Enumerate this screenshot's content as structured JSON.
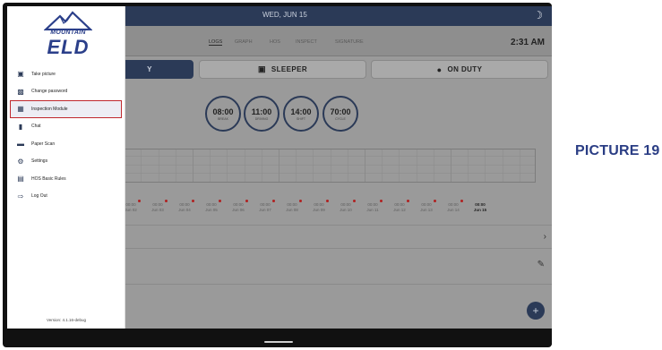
{
  "topbar": {
    "date": "WED, JUN 15",
    "clock": "2:31 AM"
  },
  "tabs": [
    "LOGS",
    "GRAPH",
    "HOS",
    "INSPECT",
    "SIGNATURE"
  ],
  "status_buttons": {
    "first": "Y",
    "sleeper": "SLEEPER",
    "on_duty": "ON DUTY"
  },
  "timers": [
    {
      "value": "08:00",
      "label": "BREAK"
    },
    {
      "value": "11:00",
      "label": "DRIVING"
    },
    {
      "value": "14:00",
      "label": "SHIFT"
    },
    {
      "value": "70:00",
      "label": "CYCLE"
    }
  ],
  "dates": [
    {
      "l1": "00:00",
      "l2": "Jun 02"
    },
    {
      "l1": "00:00",
      "l2": "Jun 03"
    },
    {
      "l1": "00:00",
      "l2": "Jun 04"
    },
    {
      "l1": "00:00",
      "l2": "Jun 05"
    },
    {
      "l1": "00:00",
      "l2": "Jun 06"
    },
    {
      "l1": "00:00",
      "l2": "Jun 07"
    },
    {
      "l1": "00:00",
      "l2": "Jun 08"
    },
    {
      "l1": "00:00",
      "l2": "Jun 09"
    },
    {
      "l1": "00:00",
      "l2": "Jun 10"
    },
    {
      "l1": "00:00",
      "l2": "Jun 11"
    },
    {
      "l1": "00:00",
      "l2": "Jun 12"
    },
    {
      "l1": "00:00",
      "l2": "Jun 13"
    },
    {
      "l1": "00:00",
      "l2": "Jun 14"
    },
    {
      "l1": "00:00",
      "l2": "Jun 15"
    }
  ],
  "drawer": {
    "logo_top": "MOUNTAIN",
    "logo_bottom": "ELD",
    "menu": [
      {
        "label": "Take picture",
        "icon": "camera-icon"
      },
      {
        "label": "Change password",
        "icon": "lock-icon"
      },
      {
        "label": "Inspection Module",
        "icon": "inspection-icon"
      },
      {
        "label": "Chat",
        "icon": "chat-icon"
      },
      {
        "label": "Paper Scan",
        "icon": "scanner-icon"
      },
      {
        "label": "Settings",
        "icon": "gear-icon"
      },
      {
        "label": "HOS Basic Rules",
        "icon": "book-icon"
      },
      {
        "label": "Log Out",
        "icon": "logout-icon"
      }
    ],
    "version": "Version: 4.1.16-debug"
  },
  "caption": "PICTURE 19",
  "colors": {
    "brand": "#2b3f8a",
    "header": "#2b3a57",
    "highlight_border": "#c0282d"
  }
}
